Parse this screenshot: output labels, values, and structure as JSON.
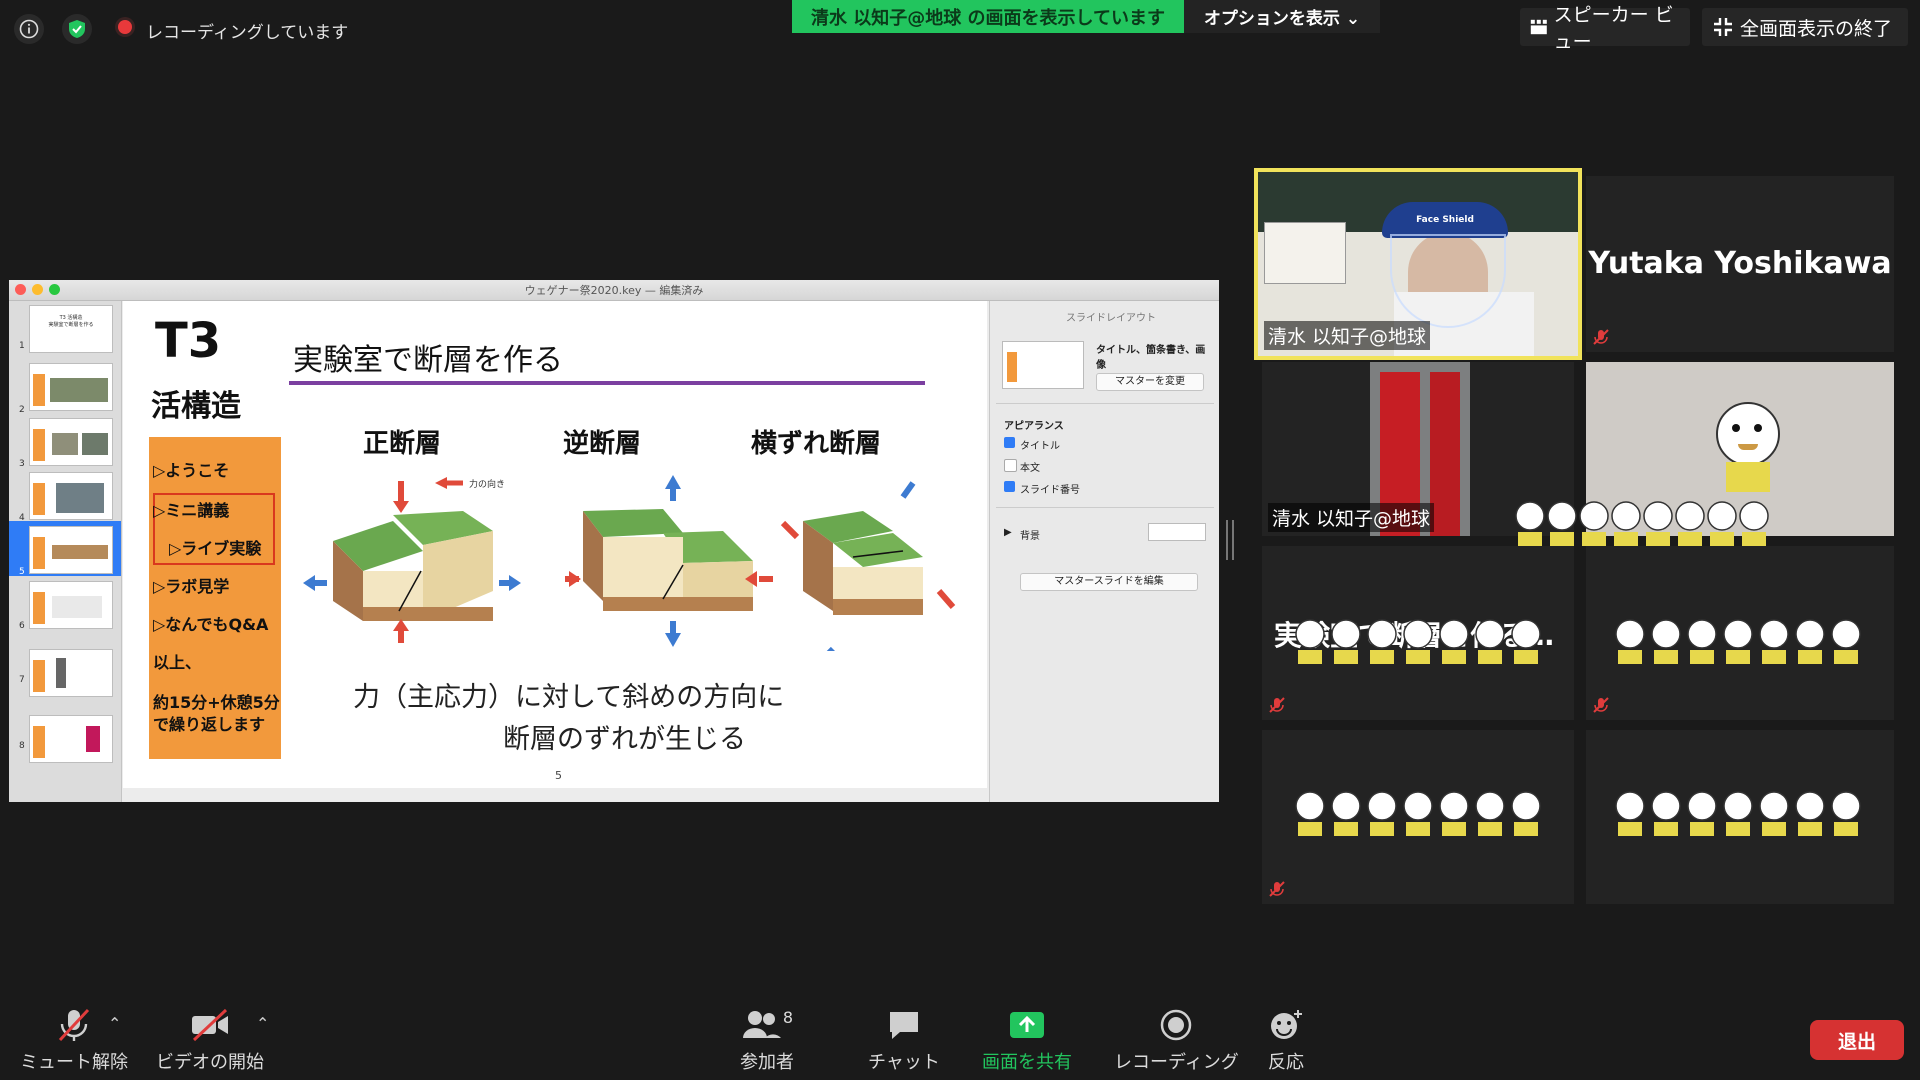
{
  "topbar": {
    "recording_label": "レコーディングしています",
    "share_banner": "清水 以知子@地球 の画面を表示しています",
    "options_label": "オプションを表示 ⌄",
    "speaker_view": "スピーカー ビュー",
    "exit_fullscreen": "全画面表示の終了"
  },
  "keynote": {
    "window_title": "ウェゲナー祭2020.key — 編集済み",
    "thumb_numbers": [
      "1",
      "2",
      "3",
      "4",
      "5",
      "6",
      "7",
      "8"
    ],
    "slide": {
      "badge_line1": "T3",
      "badge_line2": "活構造",
      "title": "実験室で断層を作る",
      "menu": [
        "▷ようこそ",
        "▷ミニ講義",
        "▷ライブ実験",
        "▷ラボ見学",
        "▷なんでもQ&A",
        "以上、",
        "約15分+休憩5分",
        "で繰り返します"
      ],
      "fault_labels": [
        "正断層",
        "逆断層",
        "横ずれ断層"
      ],
      "force_note": "力の向き",
      "caption_line1": "力（主応力）に対して斜めの方向に",
      "caption_line2": "断層のずれが生じる",
      "page_number": "5"
    },
    "side_panel": {
      "header": "スライドレイアウト",
      "layout_name": "タイトル、箇条書き、画像",
      "change_master": "マスターを変更",
      "appearance": "アピアランス",
      "opt_title": "タイトル",
      "opt_body": "本文",
      "opt_slide_number": "スライド番号",
      "background": "背景",
      "edit_master": "マスタースライドを編集"
    }
  },
  "videos": {
    "tile1_name": "清水 以知子@地球",
    "tile2_name": "Yutaka Yoshikawa",
    "tile3_name": "清水 以知子@地球",
    "tile5_text": "実験室で断層を作る…",
    "face_shield_text": "Face Shield"
  },
  "toolbar": {
    "unmute": "ミュート解除",
    "start_video": "ビデオの開始",
    "participants": "参加者",
    "participants_count": "8",
    "chat": "チャット",
    "share_screen": "画面を共有",
    "recording": "レコーディング",
    "reactions": "反応",
    "leave": "退出"
  },
  "colors": {
    "accent_green": "#22c55e",
    "leave_red": "#d63232",
    "slide_orange": "#f2993c",
    "slide_rule_purple": "#7b3fa0",
    "active_speaker": "#f1e35b"
  }
}
